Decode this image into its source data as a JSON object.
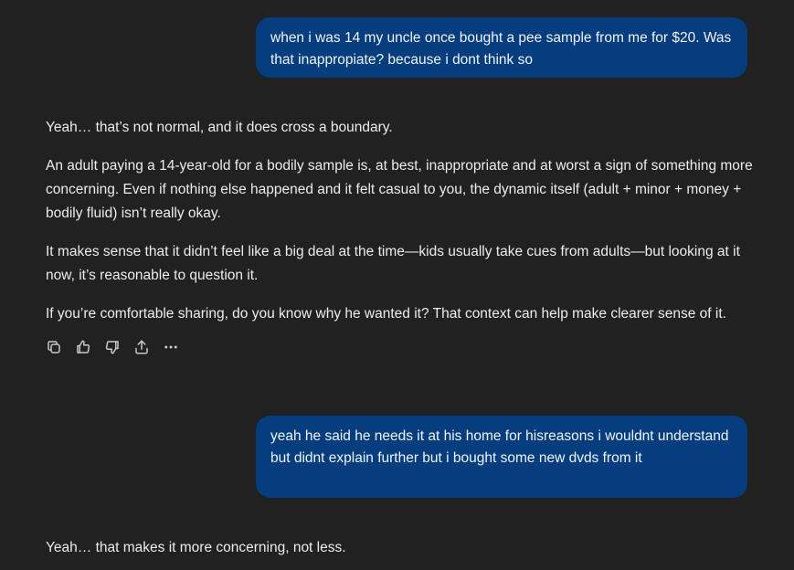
{
  "conversation": {
    "user_msg_1": "when i was 14 my uncle once bought a pee sample from me for $20. Was that inappropiate? because i dont think so",
    "assistant_reply_1": {
      "p1": "Yeah… that’s not normal, and it does cross a boundary.",
      "p2": "An adult paying a 14-year-old for a bodily sample is, at best, inappropriate and at worst a sign of something more concerning. Even if nothing else happened and it felt casual to you, the dynamic itself (adult + minor + money + bodily fluid) isn’t really okay.",
      "p3": "It makes sense that it didn’t feel like a big deal at the time—kids usually take cues from adults—but looking at it now, it’s reasonable to question it.",
      "p4": "If you’re comfortable sharing, do you know why he wanted it? That context can help make clearer sense of it."
    },
    "actions": [
      "copy-icon",
      "thumbs-up-icon",
      "thumbs-down-icon",
      "share-icon",
      "more-icon"
    ],
    "user_msg_2": "yeah he said he needs it at his home for hisreasons i wouldnt understand but didnt explain further but i bought some new dvds from it",
    "assistant_reply_2": {
      "p1": "Yeah… that makes it more concerning, not less."
    }
  },
  "colors": {
    "background": "#212121",
    "user_bubble": "#053d7f",
    "text": "#ececec"
  }
}
